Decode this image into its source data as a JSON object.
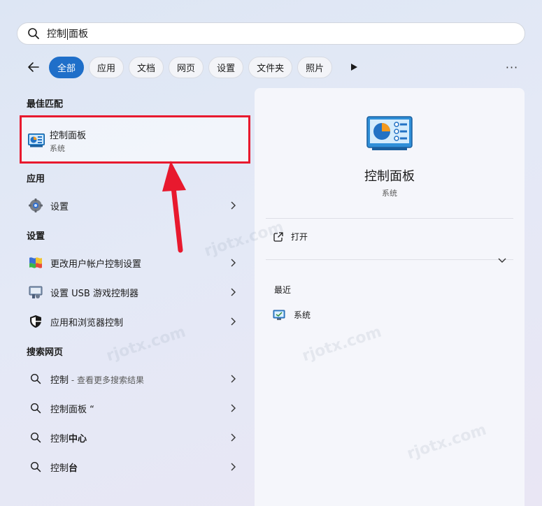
{
  "search": {
    "query_before_caret": "控制",
    "query_after_caret": "面板"
  },
  "filters": {
    "tabs": [
      {
        "label": "全部",
        "active": true
      },
      {
        "label": "应用",
        "active": false
      },
      {
        "label": "文档",
        "active": false
      },
      {
        "label": "网页",
        "active": false
      },
      {
        "label": "设置",
        "active": false
      },
      {
        "label": "文件夹",
        "active": false
      },
      {
        "label": "照片",
        "active": false
      }
    ],
    "more_label": "···"
  },
  "best_match": {
    "header": "最佳匹配",
    "title": "控制面板",
    "subtitle": "系统"
  },
  "apps": {
    "header": "应用",
    "items": [
      {
        "label": "设置",
        "icon": "gear-icon"
      }
    ]
  },
  "settings": {
    "header": "设置",
    "items": [
      {
        "label": "更改用户帐户控制设置",
        "icon": "uac-flag-icon"
      },
      {
        "label": "设置 USB 游戏控制器",
        "icon": "game-controller-icon"
      },
      {
        "label": "应用和浏览器控制",
        "icon": "shield-icon"
      }
    ]
  },
  "web": {
    "header": "搜索网页",
    "items": [
      {
        "bold": "控制",
        "light": " - 查看更多搜索结果"
      },
      {
        "bold": "控制面板 “",
        "light": ""
      },
      {
        "plain": "控制",
        "bold": "中心"
      },
      {
        "plain": "控制",
        "bold": "台"
      }
    ]
  },
  "detail": {
    "title": "控制面板",
    "subtitle": "系统",
    "open_label": "打开",
    "recent_header": "最近",
    "recent_items": [
      {
        "label": "系统",
        "icon": "system-monitor-icon"
      }
    ]
  },
  "colors": {
    "accent": "#1f6fc9",
    "highlight_border": "#e8192e",
    "arrow": "#e8192e"
  },
  "watermark": "rjotx.com"
}
